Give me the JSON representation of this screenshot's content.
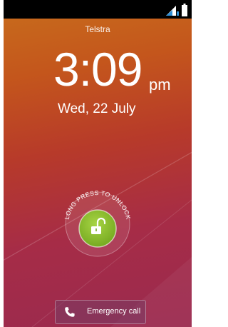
{
  "status_bar": {
    "signal_icon": "signal-strength-icon",
    "battery_icon": "battery-icon"
  },
  "lockscreen": {
    "carrier": "Telstra",
    "time": "3:09",
    "ampm": "pm",
    "date": "Wed, 22 July",
    "unlock_hint": "LONG PRESS TO UNLOCK",
    "unlock_icon": "unlocked-padlock-icon"
  },
  "emergency": {
    "label": "Emergency call",
    "icon": "phone-icon"
  },
  "colors": {
    "status_bar": "#000000",
    "unlock_button": "#8dbf2c",
    "text": "#ffffff"
  }
}
